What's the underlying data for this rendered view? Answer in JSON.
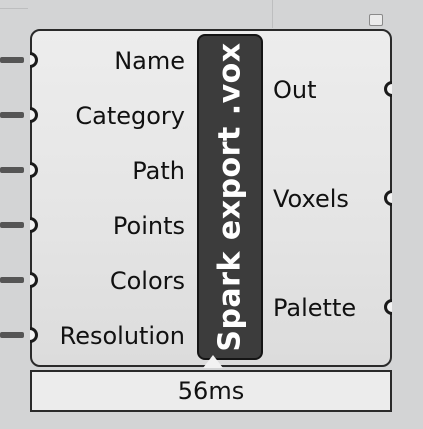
{
  "component": {
    "nickname": "Spark export .vox",
    "inputs": [
      {
        "label": "Name"
      },
      {
        "label": "Category"
      },
      {
        "label": "Path"
      },
      {
        "label": "Points"
      },
      {
        "label": "Colors"
      },
      {
        "label": "Resolution"
      }
    ],
    "outputs": [
      {
        "label": "Out"
      },
      {
        "label": "Voxels"
      },
      {
        "label": "Palette"
      }
    ],
    "timing": "56ms"
  }
}
